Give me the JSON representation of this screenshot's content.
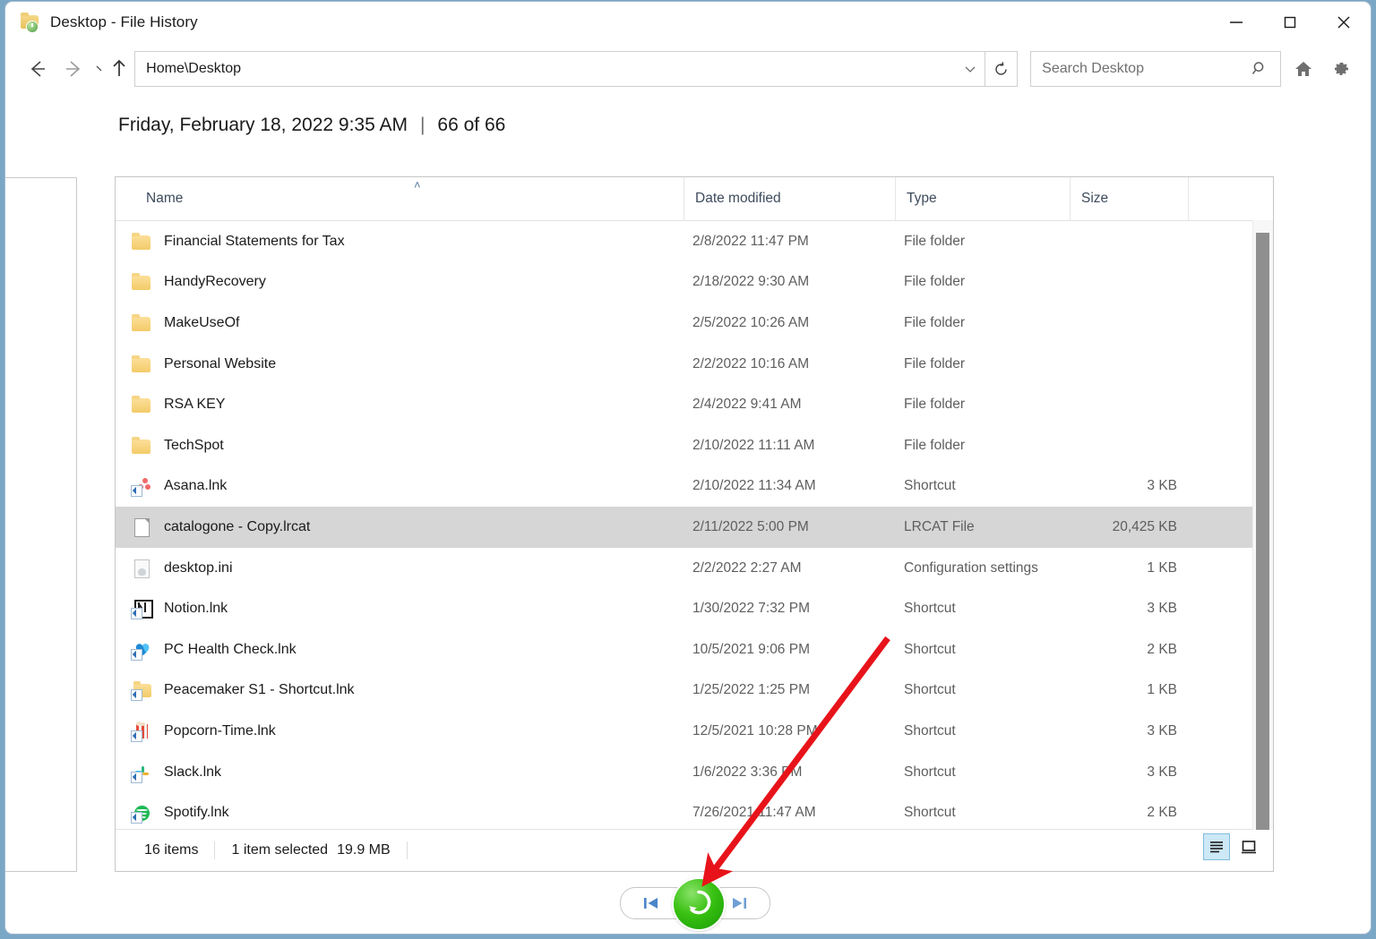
{
  "window": {
    "title": "Desktop - File History",
    "icon": "folder-history-icon",
    "controls": {
      "minimize": "–",
      "maximize": "□",
      "close": "✕"
    }
  },
  "toolbar": {
    "back_icon": "back-arrow-icon",
    "forward_icon": "forward-arrow-icon",
    "recent_icon": "recent-locations-chevron-icon",
    "up_icon": "up-arrow-icon",
    "address_value": "Home\\Desktop",
    "address_chevron_icon": "chevron-down-icon",
    "refresh_icon": "refresh-icon",
    "search_placeholder": "Search Desktop",
    "search_icon": "search-icon",
    "home_icon": "home-icon",
    "settings_icon": "gear-icon"
  },
  "version_header": {
    "date": "Friday, February 18, 2022 9:35 AM",
    "separator": "|",
    "position": "66 of 66"
  },
  "columns": {
    "name": "Name",
    "date_modified": "Date modified",
    "type": "Type",
    "size": "Size",
    "sort_caret": "˄"
  },
  "files": [
    {
      "name": "Financial Statements for Tax",
      "date": "2/8/2022 11:47 PM",
      "type": "File folder",
      "size": "",
      "icon": "folder-icon",
      "selected": false
    },
    {
      "name": "HandyRecovery",
      "date": "2/18/2022 9:30 AM",
      "type": "File folder",
      "size": "",
      "icon": "folder-icon",
      "selected": false
    },
    {
      "name": "MakeUseOf",
      "date": "2/5/2022 10:26 AM",
      "type": "File folder",
      "size": "",
      "icon": "folder-icon",
      "selected": false
    },
    {
      "name": "Personal Website",
      "date": "2/2/2022 10:16 AM",
      "type": "File folder",
      "size": "",
      "icon": "folder-icon",
      "selected": false
    },
    {
      "name": "RSA KEY",
      "date": "2/4/2022 9:41 AM",
      "type": "File folder",
      "size": "",
      "icon": "folder-icon",
      "selected": false
    },
    {
      "name": "TechSpot",
      "date": "2/10/2022 11:11 AM",
      "type": "File folder",
      "size": "",
      "icon": "folder-icon",
      "selected": false
    },
    {
      "name": "Asana.lnk",
      "date": "2/10/2022 11:34 AM",
      "type": "Shortcut",
      "size": "3 KB",
      "icon": "asana-shortcut-icon",
      "selected": false
    },
    {
      "name": "catalogone - Copy.lrcat",
      "date": "2/11/2022 5:00 PM",
      "type": "LRCAT File",
      "size": "20,425 KB",
      "icon": "generic-file-icon",
      "selected": true
    },
    {
      "name": "desktop.ini",
      "date": "2/2/2022 2:27 AM",
      "type": "Configuration settings",
      "size": "1 KB",
      "icon": "ini-file-icon",
      "selected": false
    },
    {
      "name": "Notion.lnk",
      "date": "1/30/2022 7:32 PM",
      "type": "Shortcut",
      "size": "3 KB",
      "icon": "notion-shortcut-icon",
      "selected": false
    },
    {
      "name": "PC Health Check.lnk",
      "date": "10/5/2021 9:06 PM",
      "type": "Shortcut",
      "size": "2 KB",
      "icon": "pchealth-shortcut-icon",
      "selected": false
    },
    {
      "name": "Peacemaker S1 - Shortcut.lnk",
      "date": "1/25/2022 1:25 PM",
      "type": "Shortcut",
      "size": "1 KB",
      "icon": "folder-shortcut-icon",
      "selected": false
    },
    {
      "name": "Popcorn-Time.lnk",
      "date": "12/5/2021 10:28 PM",
      "type": "Shortcut",
      "size": "3 KB",
      "icon": "popcorn-shortcut-icon",
      "selected": false
    },
    {
      "name": "Slack.lnk",
      "date": "1/6/2022 3:36 PM",
      "type": "Shortcut",
      "size": "3 KB",
      "icon": "slack-shortcut-icon",
      "selected": false
    },
    {
      "name": "Spotify.lnk",
      "date": "7/26/2021 11:47 AM",
      "type": "Shortcut",
      "size": "2 KB",
      "icon": "spotify-shortcut-icon",
      "selected": false
    }
  ],
  "status": {
    "item_count": "16 items",
    "selection": "1 item selected",
    "selection_size": "19.9 MB"
  },
  "view_toggle": {
    "details_icon": "details-view-icon",
    "large_icons_icon": "large-icons-view-icon",
    "active": "details"
  },
  "transport": {
    "previous_icon": "previous-version-icon",
    "restore_icon": "restore-circular-arrow-icon",
    "next_icon": "next-version-icon"
  },
  "annotation": {
    "arrow_color": "#e8131a",
    "points_to": "restore-button"
  },
  "colors": {
    "accent": "#cde8f6",
    "selection": "#d6d6d6",
    "restore_green": "#39c112",
    "desktop": "#7ba7c7"
  }
}
